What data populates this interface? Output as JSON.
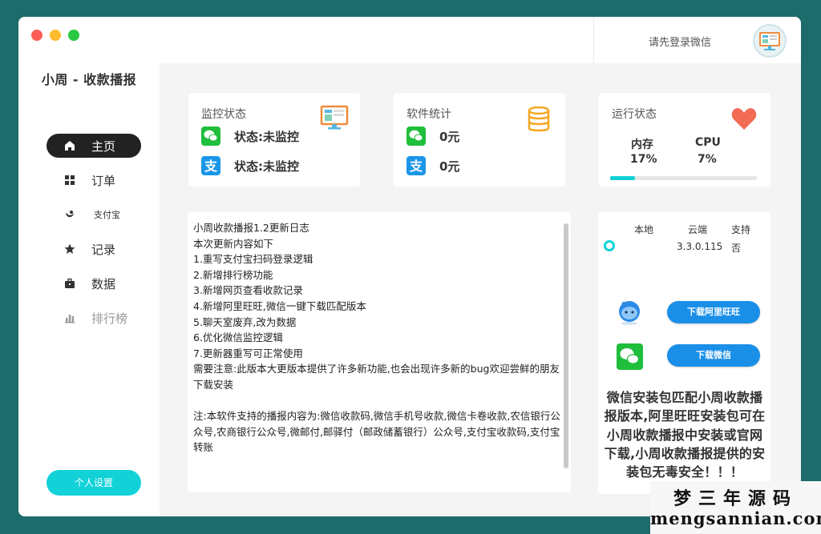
{
  "app": {
    "title": "小周 - 收款播报"
  },
  "sidebar": {
    "items": [
      {
        "label": "主页",
        "icon": "home-icon",
        "active": true
      },
      {
        "label": "订单",
        "icon": "grid-icon"
      },
      {
        "label": "支付宝",
        "icon": "alipay-leaf-icon"
      },
      {
        "label": "记录",
        "icon": "star-icon"
      },
      {
        "label": "数据",
        "icon": "briefcase-icon"
      },
      {
        "label": "排行榜",
        "icon": "bar-chart-icon",
        "muted": true
      }
    ],
    "settings_label": "个人设置"
  },
  "header": {
    "login_text": "请先登录微信"
  },
  "monitor": {
    "title": "监控状态",
    "wechat_status": "状态:未监控",
    "alipay_status": "状态:未监控"
  },
  "stats": {
    "title": "软件统计",
    "wechat_amount": "0元",
    "alipay_amount": "0元"
  },
  "runtime": {
    "title": "运行状态",
    "memory_label": "内存",
    "memory_value": "17%",
    "cpu_label": "CPU",
    "cpu_value": "7%",
    "memory_progress": 0.17
  },
  "log": {
    "lines": [
      "小周收款播报1.2更新日志",
      "本次更新内容如下",
      "1.重写支付宝扫码登录逻辑",
      "2.新增排行榜功能",
      "3.新增网页查看收款记录",
      "4.新增阿里旺旺,微信一键下载匹配版本",
      "5.聊天室废弃,改为数据",
      "6.优化微信监控逻辑",
      "7.更新器重写可正常使用"
    ],
    "warning": "需要注意:此版本大更版本提供了许多新功能,也会出现许多新的bug欢迎尝鲜的朋友下载安装",
    "note": "注:本软件支持的播报内容为:微信收款码,微信手机号收款,微信卡卷收款,农信银行公众号,农商银行公众号,微邮付,邮驿付（邮政储蓄银行）公众号,支付宝收款码,支付宝转账"
  },
  "version": {
    "headers": [
      "本地",
      "云端",
      "支持"
    ],
    "local": "",
    "cloud": "3.3.0.115",
    "supported": "否",
    "download_wangwang": "下载阿里旺旺",
    "download_wechat": "下载微信",
    "notice": "微信安装包匹配小周收款播报版本,阿里旺旺安装包可在小周收款播报中安装或官网下载,小周收款播报提供的安装包无毒安全！！！"
  },
  "watermark": {
    "top": "梦三年源码",
    "bottom": "mengsannian.com"
  },
  "colors": {
    "accent": "#12d2d8",
    "wechat": "#1fbe3c",
    "alipay": "#1a96e8",
    "heart": "#f36a55",
    "database": "#f5a623",
    "download_button": "#1a8fe8"
  }
}
